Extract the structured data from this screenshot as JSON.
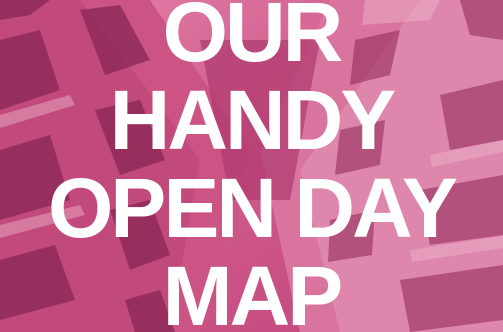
{
  "hero": {
    "headline_lines": [
      "OUR",
      "HANDY",
      "OPEN DAY",
      "MAP"
    ],
    "text_color": "#ffffff",
    "tint_color": "#d45a8c",
    "background_image": "pink-tinted-building-looking-up"
  }
}
